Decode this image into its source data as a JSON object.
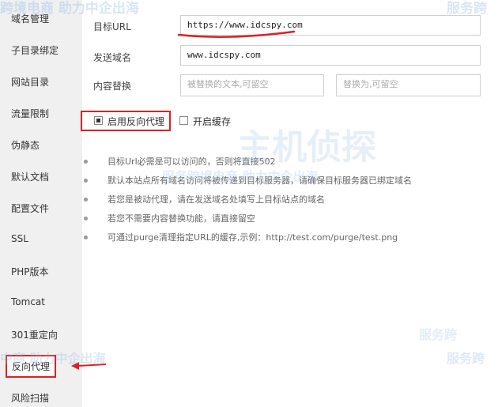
{
  "sidebar": {
    "items": [
      {
        "label": "域名管理"
      },
      {
        "label": "子目录绑定"
      },
      {
        "label": "网站目录"
      },
      {
        "label": "流量限制"
      },
      {
        "label": "伪静态"
      },
      {
        "label": "默认文档"
      },
      {
        "label": "配置文件"
      },
      {
        "label": "SSL"
      },
      {
        "label": "PHP版本"
      },
      {
        "label": "Tomcat"
      },
      {
        "label": "301重定向"
      },
      {
        "label": "反向代理"
      },
      {
        "label": "风险扫描"
      }
    ]
  },
  "form": {
    "target_url_label": "目标URL",
    "target_url_value": "https://www.idcspy.com",
    "send_domain_label": "发送域名",
    "send_domain_value": "www.idcspy.com",
    "replace_label": "内容替换",
    "replace_from_placeholder": "被替换的文本,可留空",
    "replace_to_placeholder": "替换为,可留空",
    "enable_proxy_label": "启用反向代理",
    "enable_proxy_checked": true,
    "enable_cache_label": "开启缓存",
    "enable_cache_checked": false
  },
  "tips": [
    "目标Url必需是可以访问的，否则将直接502",
    "默认本站点所有域名访问将被传递到目标服务器，请确保目标服务器已绑定域名",
    "若您是被动代理，请在发送域名处填写上目标站点的域名",
    "若您不需要内容替换功能，请直接留空",
    "可通过purge清理指定URL的缓存,示例：http://test.com/purge/test.png"
  ],
  "watermark": {
    "text_1": "跨境电商 助力中企出海",
    "text_2": "服务跨",
    "text_3": "主机侦探",
    "text_4": "服务跨境电商 助力中企出海",
    "text_5": "中商 助力中企出海",
    "text_6": "服务跨",
    "text_7": "服务跨"
  },
  "colors": {
    "highlight_red": "#e02020",
    "sidebar_bg": "#f0f0f0"
  }
}
